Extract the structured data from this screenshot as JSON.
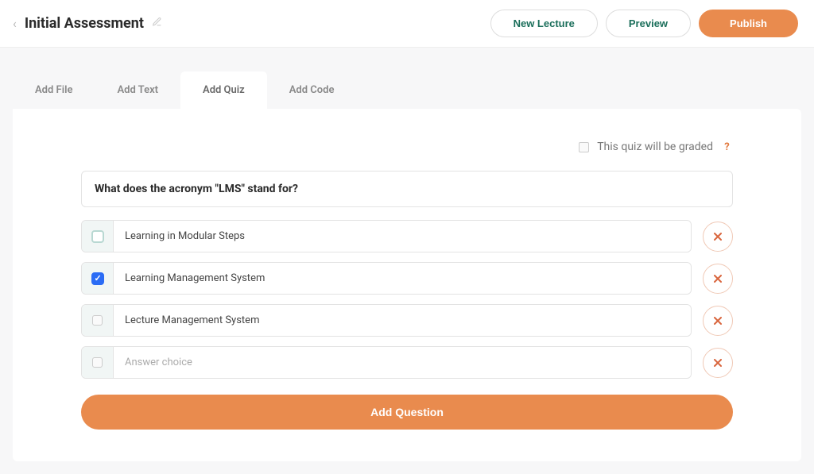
{
  "header": {
    "title": "Initial Assessment",
    "actions": {
      "new_lecture": "New Lecture",
      "preview": "Preview",
      "publish": "Publish"
    }
  },
  "tabs": [
    {
      "label": "Add File",
      "active": false
    },
    {
      "label": "Add Text",
      "active": false
    },
    {
      "label": "Add Quiz",
      "active": true
    },
    {
      "label": "Add Code",
      "active": false
    }
  ],
  "quiz": {
    "graded_label": "This quiz will be graded",
    "graded_checked": false,
    "question": "What does the acronym \"LMS\" stand for?",
    "answer_placeholder": "Answer choice",
    "answers": [
      {
        "text": "Learning in Modular Steps",
        "checked": false,
        "style": "outline"
      },
      {
        "text": "Learning Management System",
        "checked": true,
        "style": "filled"
      },
      {
        "text": "Lecture Management System",
        "checked": false,
        "style": "small"
      },
      {
        "text": "",
        "checked": false,
        "style": "small"
      }
    ],
    "add_question_label": "Add Question"
  },
  "icons": {
    "edit": "pencil-icon",
    "help": "?",
    "delete": "×",
    "back": "‹"
  }
}
